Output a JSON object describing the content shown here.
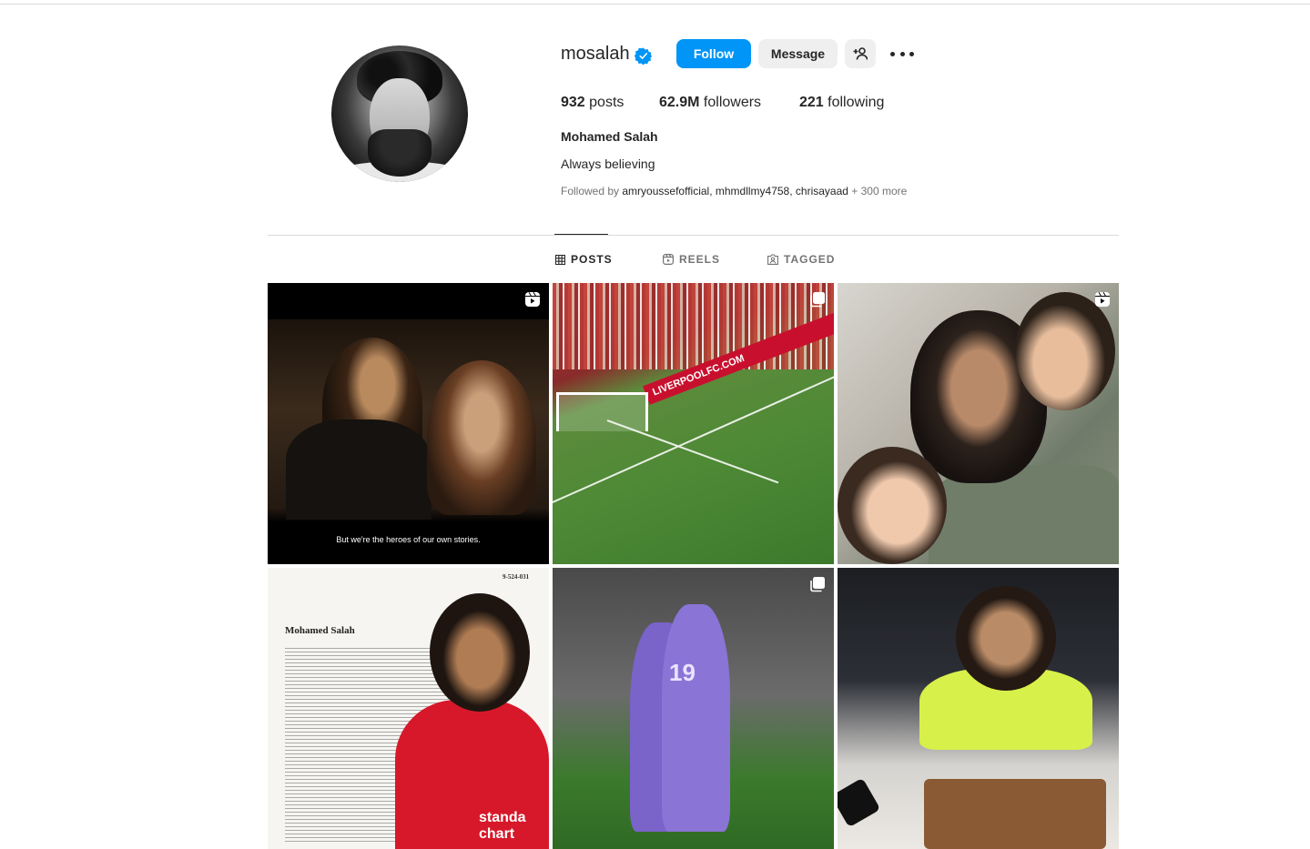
{
  "profile": {
    "username": "mosalah",
    "verified": true,
    "buttons": {
      "follow": "Follow",
      "message": "Message"
    },
    "stats": {
      "posts_count": "932",
      "posts_label": "posts",
      "followers_count": "62.9M",
      "followers_label": "followers",
      "following_count": "221",
      "following_label": "following"
    },
    "full_name": "Mohamed Salah",
    "bio": "Always believing",
    "followed_by": {
      "prefix": "Followed by",
      "names": "amryoussefofficial, mhmdllmy4758, chrisayaad",
      "more": "+ 300 more"
    }
  },
  "tabs": [
    {
      "label": "POSTS",
      "icon": "grid-icon",
      "active": true
    },
    {
      "label": "REELS",
      "icon": "reels-icon",
      "active": false
    },
    {
      "label": "TAGGED",
      "icon": "tagged-icon",
      "active": false
    }
  ],
  "posts": [
    {
      "type": "reel",
      "caption": "But we're the heroes of our own stories."
    },
    {
      "type": "carousel",
      "banner": "LIVERPOOLFC.COM"
    },
    {
      "type": "reel"
    },
    {
      "type": "carousel",
      "doc_title": "Mohamed Salah",
      "doc_number": "9-524-031",
      "sponsor_text": "standa chart"
    },
    {
      "type": "carousel",
      "jersey_number": "19"
    },
    {
      "type": "image"
    }
  ],
  "colors": {
    "accent": "#0095f6",
    "text": "#262626",
    "secondary": "#737373",
    "border": "#dbdbdb",
    "button_bg": "#efefef"
  }
}
